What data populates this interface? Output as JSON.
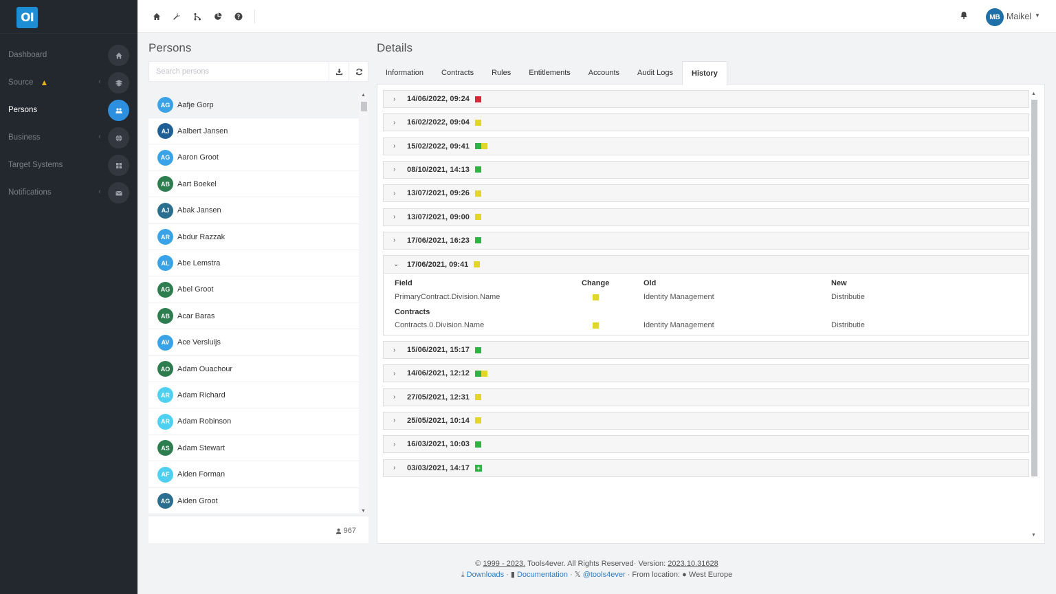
{
  "app": {
    "logo_text": "OI"
  },
  "sidebar": {
    "items": [
      {
        "label": "Dashboard",
        "icon": "home-icon",
        "active": false,
        "chevron": false,
        "warning": false
      },
      {
        "label": "Source",
        "icon": "layers-icon",
        "active": false,
        "chevron": true,
        "warning": true
      },
      {
        "label": "Persons",
        "icon": "users-icon",
        "active": true,
        "chevron": false,
        "warning": false
      },
      {
        "label": "Business",
        "icon": "globe-icon",
        "active": false,
        "chevron": true,
        "warning": false
      },
      {
        "label": "Target Systems",
        "icon": "grid-icon",
        "active": false,
        "chevron": false,
        "warning": false
      },
      {
        "label": "Notifications",
        "icon": "envelope-icon",
        "active": false,
        "chevron": true,
        "warning": false
      }
    ]
  },
  "topbar": {
    "icons": [
      "home-icon",
      "wrench-icon",
      "flow-icon",
      "pie-chart-icon",
      "help-icon"
    ],
    "user_initials": "MB",
    "user_name": "Maikel"
  },
  "persons": {
    "title": "Persons",
    "search_placeholder": "Search persons",
    "count": "967",
    "list": [
      {
        "initials": "AG",
        "name": "Aafje Gorp",
        "color": "#3aa3e8",
        "selected": true
      },
      {
        "initials": "AJ",
        "name": "Aalbert Jansen",
        "color": "#1f5f96"
      },
      {
        "initials": "AG",
        "name": "Aaron Groot",
        "color": "#3aa3e8"
      },
      {
        "initials": "AB",
        "name": "Aart Boekel",
        "color": "#2e7d4f"
      },
      {
        "initials": "AJ",
        "name": "Abak Jansen",
        "color": "#2a6f8f"
      },
      {
        "initials": "AR",
        "name": "Abdur Razzak",
        "color": "#3aa3e8"
      },
      {
        "initials": "AL",
        "name": "Abe Lemstra",
        "color": "#3aa3e8"
      },
      {
        "initials": "AG",
        "name": "Abel Groot",
        "color": "#2e7d4f"
      },
      {
        "initials": "AB",
        "name": "Acar Baras",
        "color": "#2e7d4f"
      },
      {
        "initials": "AV",
        "name": "Ace Versluijs",
        "color": "#3aa3e8"
      },
      {
        "initials": "AO",
        "name": "Adam Ouachour",
        "color": "#2e7d4f"
      },
      {
        "initials": "AR",
        "name": "Adam Richard",
        "color": "#4fd0f0"
      },
      {
        "initials": "AR",
        "name": "Adam Robinson",
        "color": "#4fd0f0"
      },
      {
        "initials": "AS",
        "name": "Adam Stewart",
        "color": "#2e7d4f"
      },
      {
        "initials": "AF",
        "name": "Aiden Forman",
        "color": "#4fd0f0"
      },
      {
        "initials": "AG",
        "name": "Aiden Groot",
        "color": "#2a6f8f"
      }
    ]
  },
  "details": {
    "title": "Details",
    "tabs": [
      {
        "label": "Information",
        "active": false
      },
      {
        "label": "Contracts",
        "active": false
      },
      {
        "label": "Rules",
        "active": false
      },
      {
        "label": "Entitlements",
        "active": false
      },
      {
        "label": "Accounts",
        "active": false
      },
      {
        "label": "Audit Logs",
        "active": false
      },
      {
        "label": "History",
        "active": true
      }
    ],
    "history_before": [
      {
        "date": "14/06/2022, 09:24",
        "markers": [
          "#d9283a"
        ]
      },
      {
        "date": "16/02/2022, 09:04",
        "markers": [
          "#e3d62a"
        ]
      },
      {
        "date": "15/02/2022, 09:41",
        "markers": [
          "#2fb344",
          "#e3d62a"
        ]
      },
      {
        "date": "08/10/2021, 14:13",
        "markers": [
          "#2fb344"
        ]
      },
      {
        "date": "13/07/2021, 09:26",
        "markers": [
          "#e3d62a"
        ]
      },
      {
        "date": "13/07/2021, 09:00",
        "markers": [
          "#e3d62a"
        ]
      },
      {
        "date": "17/06/2021, 16:23",
        "markers": [
          "#2fb344"
        ]
      }
    ],
    "expanded": {
      "date": "17/06/2021, 09:41",
      "marker": "#e3d62a",
      "headers": {
        "field": "Field",
        "change": "Change",
        "old": "Old",
        "new": "New"
      },
      "row1": {
        "field": "PrimaryContract.Division.Name",
        "old": "Identity Management",
        "new": "Distributie"
      },
      "section": "Contracts",
      "row2": {
        "field": "Contracts.0.Division.Name",
        "old": "Identity Management",
        "new": "Distributie"
      }
    },
    "history_after": [
      {
        "date": "15/06/2021, 15:17",
        "markers": [
          "#2fb344"
        ]
      },
      {
        "date": "14/06/2021, 12:12",
        "markers": [
          "#2fb344",
          "#e3d62a"
        ]
      },
      {
        "date": "27/05/2021, 12:31",
        "markers": [
          "#e3d62a"
        ]
      },
      {
        "date": "25/05/2021, 10:14",
        "markers": [
          "#e3d62a"
        ]
      },
      {
        "date": "16/03/2021, 10:03",
        "markers": [
          "#2fb344"
        ]
      },
      {
        "date": "03/03/2021, 14:17",
        "markers": [
          "plus"
        ]
      }
    ]
  },
  "footer": {
    "copyright_prefix": "©",
    "years": "1999 - 2023.",
    "company": "Tools4ever. All Rights Reserved· Version:",
    "version": "2023.10.31628",
    "downloads": "Downloads",
    "documentation": "Documentation",
    "twitter": "@tools4ever",
    "location_label": "· From location:",
    "location": "West Europe"
  }
}
